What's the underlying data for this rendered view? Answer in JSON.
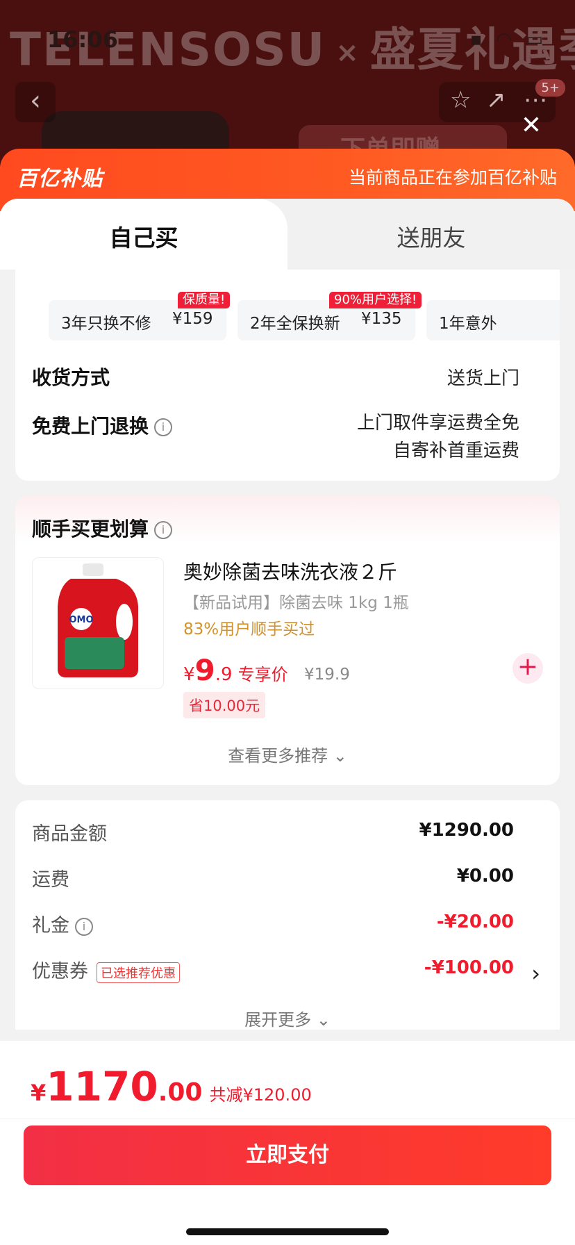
{
  "backdrop": {
    "time": "16:06",
    "banner": "TELENSOSU",
    "banner_x": "×",
    "banner_right": "盛夏礼遇季",
    "badge": "5+",
    "promo": "下单即赠"
  },
  "subsidy": {
    "logo": "百亿补贴",
    "note": "当前商品正在参加百亿补贴"
  },
  "tabs": [
    {
      "label": "自己买",
      "active": true
    },
    {
      "label": "送朋友",
      "active": false
    }
  ],
  "services": [
    {
      "name": "3年只换不修",
      "price": "¥159",
      "tag": "保质量!"
    },
    {
      "name": "2年全保换新",
      "price": "¥135",
      "tag": "90%用户选择!"
    },
    {
      "name": "1年意外",
      "price": "",
      "tag": ""
    }
  ],
  "delivery": {
    "label": "收货方式",
    "value": "送货上门"
  },
  "return": {
    "label": "免费上门退换",
    "line1": "上门取件享运费全免",
    "line2": "自寄补首重运费"
  },
  "addon": {
    "title": "顺手买更划算",
    "product_name": "奥妙除菌去味洗衣液２斤",
    "product_desc": "【新品试用】除菌去味 1kg 1瓶",
    "users": "83%用户顺手买过",
    "price_yen": "¥",
    "price_int": "9",
    "price_dec": ".9",
    "price_label": "专享价",
    "original_price": "¥19.9",
    "save": "省10.00元",
    "more": "查看更多推荐",
    "image_brand": "OMO"
  },
  "summary": {
    "goods_label": "商品金额",
    "goods_value": "¥1290.00",
    "shipping_label": "运费",
    "shipping_value": "¥0.00",
    "gift_label": "礼金",
    "gift_value": "-¥20.00",
    "coupon_label": "优惠券",
    "coupon_tag": "已选推荐优惠",
    "coupon_value": "-¥100.00",
    "expand": "展开更多"
  },
  "footer": {
    "total_yen": "¥",
    "total_int": "1170",
    "total_dec": ".00",
    "reduced": "共减¥120.00",
    "pay_button": "立即支付"
  },
  "colors": {
    "accent": "#f01b2d",
    "subsidy_bar": "#ff5222",
    "addon_users": "#d2922d"
  }
}
